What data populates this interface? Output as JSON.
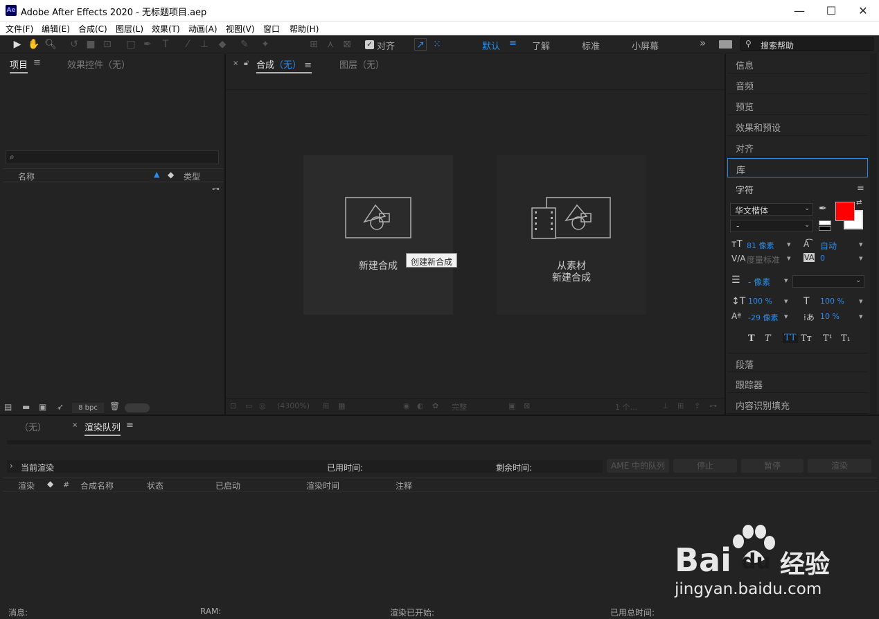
{
  "window": {
    "title": "Adobe After Effects 2020 - 无标题项目.aep",
    "logo": "Ae",
    "minimize": "—",
    "maximize": "☐",
    "close": "✕"
  },
  "menu": [
    "文件(F)",
    "编辑(E)",
    "合成(C)",
    "图层(L)",
    "效果(T)",
    "动画(A)",
    "视图(V)",
    "窗口",
    "帮助(H)"
  ],
  "toolbar": {
    "align_label": "对齐",
    "workspaces": [
      "默认",
      "了解",
      "标准",
      "小屏幕"
    ],
    "more": "»",
    "search_placeholder": "搜索帮助"
  },
  "project_panel": {
    "tab_project": "项目",
    "tab_effects": "效果控件（无）",
    "search_icon_glyph": "⌕",
    "col_name": "名称",
    "col_type": "类型",
    "bpc": "8 bpc"
  },
  "comp_panel": {
    "tab_comp": "合成",
    "tab_comp_none": "（无）",
    "tab_layer": "图层（无）",
    "card_new": "新建合成",
    "card_from_footage_line1": "从素材",
    "card_from_footage_line2": "新建合成",
    "tooltip": "创建新合成",
    "zoom": "(4300%)",
    "quality": "完整",
    "views": "1 个..."
  },
  "right_panel": {
    "items": [
      "信息",
      "音频",
      "预览",
      "效果和预设",
      "对齐",
      "库"
    ],
    "character_title": "字符",
    "font_family": "华文楷体",
    "font_style": "-",
    "font_size": "81 像素",
    "leading": "自动",
    "kerning": "度量标准",
    "tracking": "0",
    "stroke": "- 像素",
    "vscale": "100 %",
    "hscale": "100 %",
    "baseline": "-29 像素",
    "tsume": "10 %",
    "styles": [
      "T",
      "T",
      "TT",
      "Tт",
      "T¹",
      "T₁"
    ],
    "lower_items": [
      "段落",
      "跟踪器",
      "内容识别填充"
    ],
    "fill_color": "#ff0000"
  },
  "render_panel": {
    "tab_none": "（无）",
    "tab_queue": "渲染队列",
    "current_render": "当前渲染",
    "elapsed": "已用时间:",
    "remaining": "剩余时间:",
    "btn_ame": "AME 中的队列",
    "btn_stop": "停止",
    "btn_pause": "暂停",
    "btn_render": "渲染",
    "columns": [
      "渲染",
      "#",
      "合成名称",
      "状态",
      "已启动",
      "渲染时间",
      "注释"
    ]
  },
  "status": {
    "message": "消息:",
    "ram": "RAM:",
    "render_started": "渲染已开始:",
    "total_time": "已用总时间:"
  },
  "watermark": {
    "line1": "Bai",
    "line1b": "du",
    "line1c": "经验",
    "line2": "jingyan.baidu.com"
  }
}
